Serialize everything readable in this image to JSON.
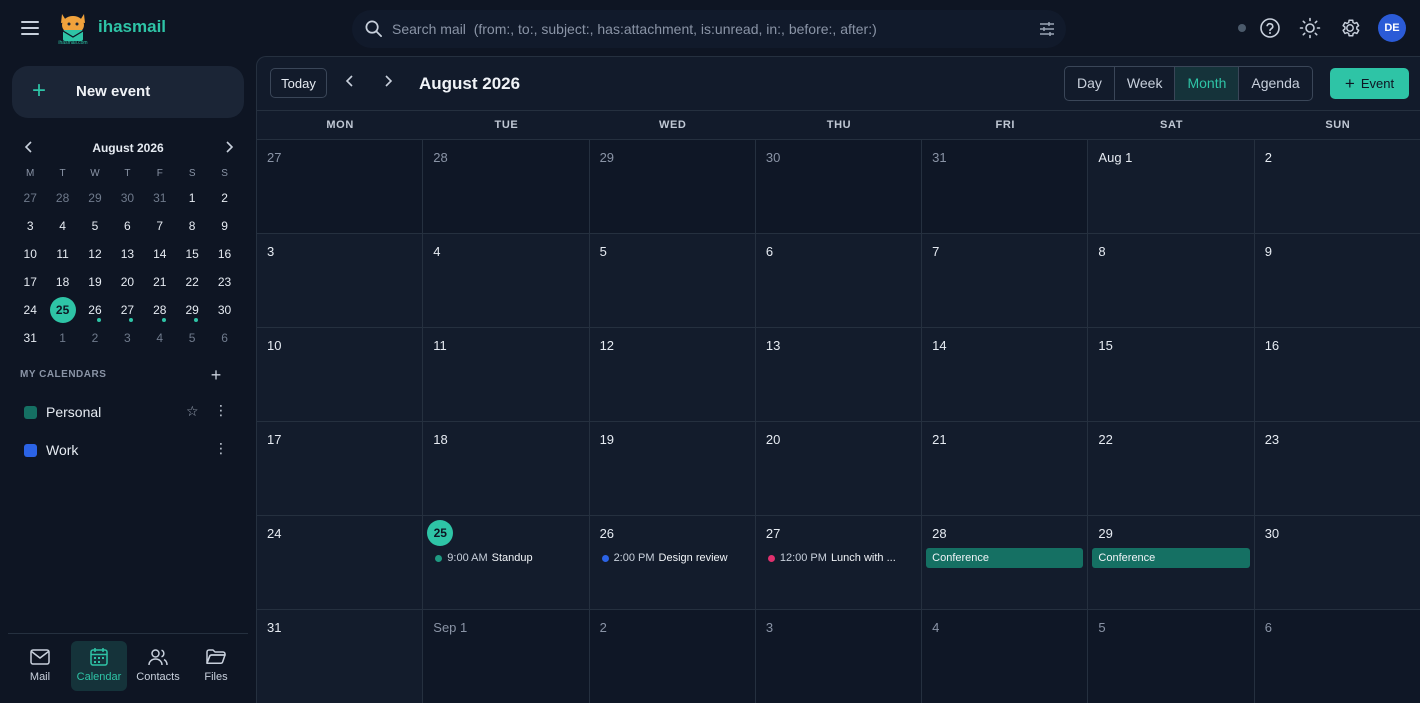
{
  "app": {
    "brand": "ihasmail",
    "logo_text": "ihasmail.com"
  },
  "search": {
    "placeholder": "Search mail  (from:, to:, subject:, has:attachment, is:unread, in:, before:, after:)"
  },
  "user": {
    "initials": "DE"
  },
  "sidebar": {
    "new_event": "New event",
    "mini_calendar": {
      "title": "August 2026",
      "weekdays": [
        "M",
        "T",
        "W",
        "T",
        "F",
        "S",
        "S"
      ],
      "days": [
        {
          "d": "27",
          "other": true
        },
        {
          "d": "28",
          "other": true
        },
        {
          "d": "29",
          "other": true
        },
        {
          "d": "30",
          "other": true
        },
        {
          "d": "31",
          "other": true
        },
        {
          "d": "1"
        },
        {
          "d": "2"
        },
        {
          "d": "3"
        },
        {
          "d": "4"
        },
        {
          "d": "5"
        },
        {
          "d": "6"
        },
        {
          "d": "7"
        },
        {
          "d": "8"
        },
        {
          "d": "9"
        },
        {
          "d": "10"
        },
        {
          "d": "11"
        },
        {
          "d": "12"
        },
        {
          "d": "13"
        },
        {
          "d": "14"
        },
        {
          "d": "15"
        },
        {
          "d": "16"
        },
        {
          "d": "17"
        },
        {
          "d": "18"
        },
        {
          "d": "19"
        },
        {
          "d": "20"
        },
        {
          "d": "21"
        },
        {
          "d": "22"
        },
        {
          "d": "23"
        },
        {
          "d": "24"
        },
        {
          "d": "25",
          "today": true
        },
        {
          "d": "26",
          "dot": true
        },
        {
          "d": "27",
          "dot": true
        },
        {
          "d": "28",
          "dot": true
        },
        {
          "d": "29",
          "dot": true
        },
        {
          "d": "30"
        },
        {
          "d": "31"
        },
        {
          "d": "1",
          "other": true
        },
        {
          "d": "2",
          "other": true
        },
        {
          "d": "3",
          "other": true
        },
        {
          "d": "4",
          "other": true
        },
        {
          "d": "5",
          "other": true
        },
        {
          "d": "6",
          "other": true
        }
      ]
    },
    "calendars_heading": "MY CALENDARS",
    "calendars": [
      {
        "name": "Personal",
        "color": "#157063",
        "starred": false
      },
      {
        "name": "Work",
        "color": "#2b63e6"
      }
    ],
    "nav": [
      {
        "label": "Mail",
        "icon": "mail-icon"
      },
      {
        "label": "Calendar",
        "icon": "calendar-icon",
        "active": true
      },
      {
        "label": "Contacts",
        "icon": "contacts-icon"
      },
      {
        "label": "Files",
        "icon": "folder-icon"
      }
    ]
  },
  "toolbar": {
    "today": "Today",
    "title": "August 2026",
    "views": [
      {
        "label": "Day"
      },
      {
        "label": "Week"
      },
      {
        "label": "Month",
        "active": true
      },
      {
        "label": "Agenda"
      }
    ],
    "event_button": "Event"
  },
  "month": {
    "weekday_headers": [
      "MON",
      "TUE",
      "WED",
      "THU",
      "FRI",
      "SAT",
      "SUN"
    ],
    "cells": [
      {
        "label": "27",
        "other": true
      },
      {
        "label": "28",
        "other": true
      },
      {
        "label": "29",
        "other": true
      },
      {
        "label": "30",
        "other": true
      },
      {
        "label": "31",
        "other": true
      },
      {
        "label": "Aug 1"
      },
      {
        "label": "2"
      },
      {
        "label": "3"
      },
      {
        "label": "4"
      },
      {
        "label": "5"
      },
      {
        "label": "6"
      },
      {
        "label": "7"
      },
      {
        "label": "8"
      },
      {
        "label": "9"
      },
      {
        "label": "10"
      },
      {
        "label": "11"
      },
      {
        "label": "12"
      },
      {
        "label": "13"
      },
      {
        "label": "14"
      },
      {
        "label": "15"
      },
      {
        "label": "16"
      },
      {
        "label": "17"
      },
      {
        "label": "18"
      },
      {
        "label": "19"
      },
      {
        "label": "20"
      },
      {
        "label": "21"
      },
      {
        "label": "22"
      },
      {
        "label": "23"
      },
      {
        "label": "24"
      },
      {
        "label": "25",
        "today": true,
        "event": {
          "time": "9:00 AM",
          "title": "Standup",
          "color": "#1f9a82"
        }
      },
      {
        "label": "26",
        "event": {
          "time": "2:00 PM",
          "title": "Design review",
          "color": "#2b63e6"
        }
      },
      {
        "label": "27",
        "event": {
          "time": "12:00 PM",
          "title": "Lunch with ...",
          "color": "#e0306e"
        }
      },
      {
        "label": "28",
        "bar": "Conference"
      },
      {
        "label": "29",
        "bar": "Conference"
      },
      {
        "label": "30"
      },
      {
        "label": "31"
      },
      {
        "label": "Sep 1",
        "other": true
      },
      {
        "label": "2",
        "other": true
      },
      {
        "label": "3",
        "other": true
      },
      {
        "label": "4",
        "other": true
      },
      {
        "label": "5",
        "other": true
      },
      {
        "label": "6",
        "other": true
      }
    ]
  }
}
